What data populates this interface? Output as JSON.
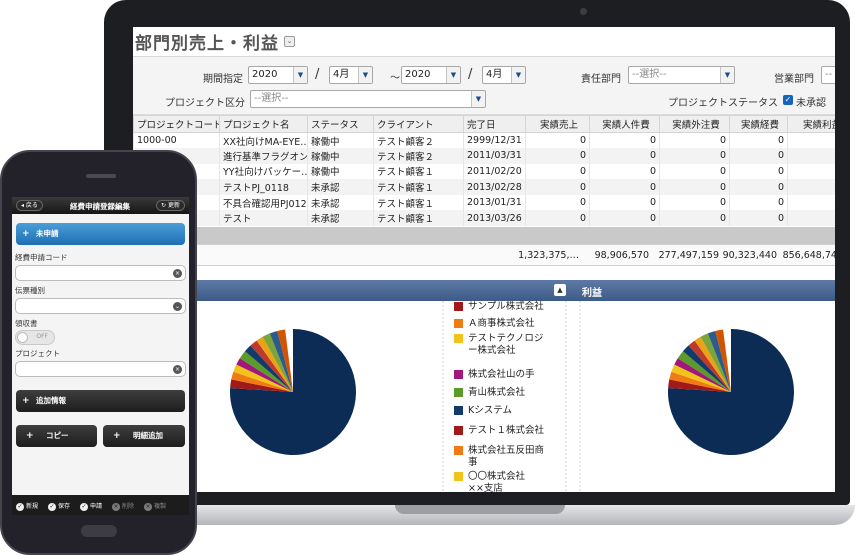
{
  "desktop": {
    "page_title": "部門別売上・利益",
    "collapse_icon": "double-chevron-down-icon",
    "filters": {
      "period_label": "期間指定",
      "from_year": "2020",
      "from_month": "4月",
      "slash": "/",
      "tilde": "～",
      "to_year": "2020",
      "to_month": "4月",
      "dept_label": "責任部門",
      "dept_value": "--選択--",
      "sales_label": "営業部門",
      "sales_value": "--",
      "project_type_label": "プロジェクト区分",
      "project_type_value": "--選択--",
      "project_status_label": "プロジェクトステータス",
      "unapproved_label": "未承認",
      "unapproved_checked": true
    },
    "table": {
      "columns": [
        "プロジェクトコード",
        "プロジェクト名",
        "ステータス",
        "クライアント",
        "完了日",
        "実績売上",
        "実績人件費",
        "実績外注費",
        "実績経費",
        "実績利益"
      ],
      "rows": [
        [
          "1000-00",
          "XX社向けMA-EYE…",
          "稼働中",
          "テスト顧客２",
          "2999/12/31",
          "0",
          "0",
          "0",
          "0",
          "0"
        ],
        [
          "",
          "進行基準フラグオン",
          "稼働中",
          "テスト顧客２",
          "2011/03/31",
          "0",
          "0",
          "0",
          "0",
          "0"
        ],
        [
          "",
          "YY社向けパッケー…",
          "稼働中",
          "テスト顧客１",
          "2011/02/20",
          "0",
          "0",
          "0",
          "0",
          "0"
        ],
        [
          "",
          "テストPJ_0118",
          "未承認",
          "テスト顧客１",
          "2013/02/28",
          "0",
          "0",
          "0",
          "0",
          "0"
        ],
        [
          "",
          "不具合確認用PJ0125",
          "未承認",
          "テスト顧客１",
          "2013/01/31",
          "0",
          "0",
          "0",
          "0",
          "0"
        ],
        [
          "",
          "テスト",
          "未承認",
          "テスト顧客１",
          "2013/03/26",
          "0",
          "0",
          "0",
          "0",
          "0"
        ]
      ],
      "totals": [
        "1,323,375,…",
        "98,906,570",
        "277,497,159",
        "90,323,440",
        "856,648,747"
      ]
    },
    "chart_panel": {
      "title": "利益",
      "toggle_icon": "triangle-up-icon",
      "legend": [
        {
          "label": "サンプル株式会社",
          "color": "#a11a1a"
        },
        {
          "label": "Ａ商事株式会社",
          "color": "#f07b15"
        },
        {
          "label": "テストテクノロジー株式会社",
          "color": "#f2c31a"
        },
        {
          "label": "株式会社山の手",
          "color": "#a0187a"
        },
        {
          "label": "青山株式会社",
          "color": "#5b9b2c"
        },
        {
          "label": "Kシステム",
          "color": "#123a6b"
        },
        {
          "label": "テスト１株式会社",
          "color": "#a11a1a"
        },
        {
          "label": "株式会社五反田商事",
          "color": "#f07b15"
        },
        {
          "label": "〇〇株式会社　××支店",
          "color": "#f2c31a"
        }
      ]
    },
    "pie_colors": [
      "#0d2c55",
      "#a11a1a",
      "#f07b15",
      "#f2c31a",
      "#a0187a",
      "#5b9b2c",
      "#123a6b",
      "#c0392b",
      "#e8a317",
      "#7aa53a",
      "#2d5c8c",
      "#d35400"
    ]
  },
  "phone": {
    "header": {
      "title": "経費申請登録編集",
      "back_label": "戻る",
      "refresh_label": "更新"
    },
    "status_section": "未申請",
    "fields": [
      {
        "label": "経費申請コード",
        "icon": "clear-icon"
      },
      {
        "label": "伝票種別",
        "icon": "chevron-down-icon"
      }
    ],
    "receipt_label": "領収書",
    "receipt_toggle": "OFF",
    "project_label": "プロジェクト",
    "project_icon": "clear-icon",
    "extra_section": "追加情報",
    "copy_label": "コピー",
    "add_detail_label": "明細追加",
    "footer": [
      {
        "label": "新規",
        "enabled": true
      },
      {
        "label": "保存",
        "enabled": true
      },
      {
        "label": "申請",
        "enabled": true
      },
      {
        "label": "削除",
        "enabled": false
      },
      {
        "label": "複製",
        "enabled": false
      }
    ]
  }
}
